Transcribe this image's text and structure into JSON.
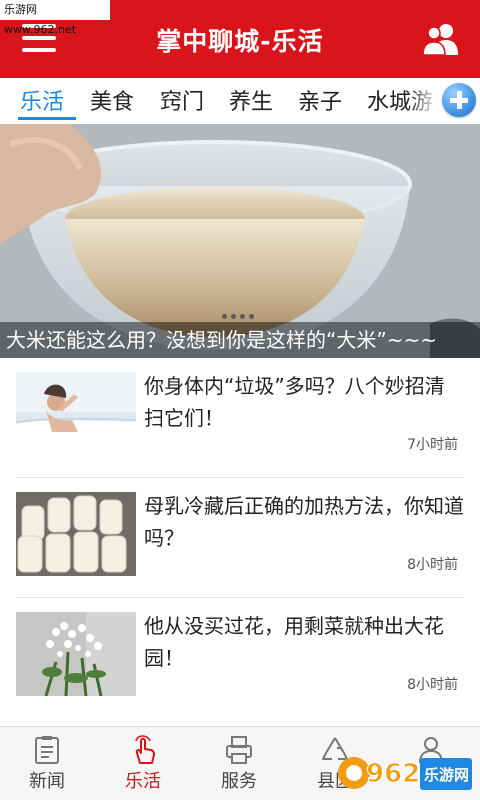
{
  "watermark_top": "乐游网 www.962.net",
  "header": {
    "title": "掌中聊城-乐活",
    "menu_icon": "menu-icon",
    "user_icon": "user-group-icon",
    "bg_color": "#d9141b"
  },
  "tabs": {
    "items": [
      "乐活",
      "美食",
      "窍门",
      "养生",
      "亲子",
      "水城游"
    ],
    "active": "乐活",
    "active_color": "#1e88e5",
    "add_icon": "plus-icon"
  },
  "banner": {
    "caption": "大米还能这么用？没想到你是这样的“大米”~~~",
    "dot_count": 4
  },
  "news": [
    {
      "headline": "你身体内“垃圾”多吗？八个妙招清扫它们！",
      "time": "7小时前",
      "thumb": "bathtub-photo"
    },
    {
      "headline": "母乳冷藏后正确的加热方法，你知道吗？",
      "time": "8小时前",
      "thumb": "milk-bottles-photo"
    },
    {
      "headline": "他从没买过花，用剩菜就种出大花园！",
      "time": "8小时前",
      "thumb": "flower-plant-photo"
    }
  ],
  "bottom_nav": {
    "items": [
      {
        "label": "新闻",
        "icon": "news-icon"
      },
      {
        "label": "乐活",
        "icon": "tap-hand-icon"
      },
      {
        "label": "服务",
        "icon": "printer-service-icon"
      },
      {
        "label": "县区",
        "icon": "recycle-icon"
      },
      {
        "label": "",
        "icon": "user-icon"
      }
    ],
    "active": "乐活",
    "active_color": "#d9141b"
  },
  "watermark_bottom": {
    "logo_text": "962",
    "site_text": "乐游网"
  }
}
